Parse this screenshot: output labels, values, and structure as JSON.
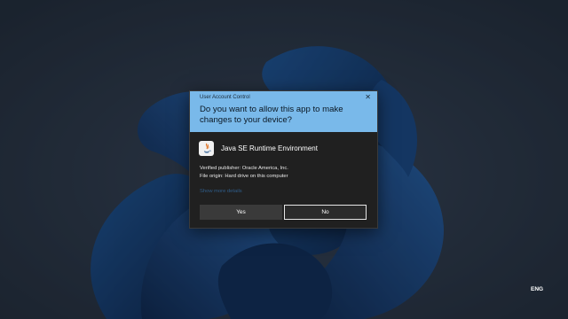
{
  "dialog": {
    "title": "User Account Control",
    "question": "Do you want to allow this app to make changes to your device?",
    "app_name": "Java SE Runtime Environment",
    "publisher": "Verified publisher: Oracle America, Inc.",
    "origin": "File origin: Hard drive on this computer",
    "more_details": "Show more details",
    "yes_label": "Yes",
    "no_label": "No",
    "header_color": "#79b9ea",
    "body_color": "#202020"
  },
  "taskbar": {
    "language": "ENG"
  }
}
